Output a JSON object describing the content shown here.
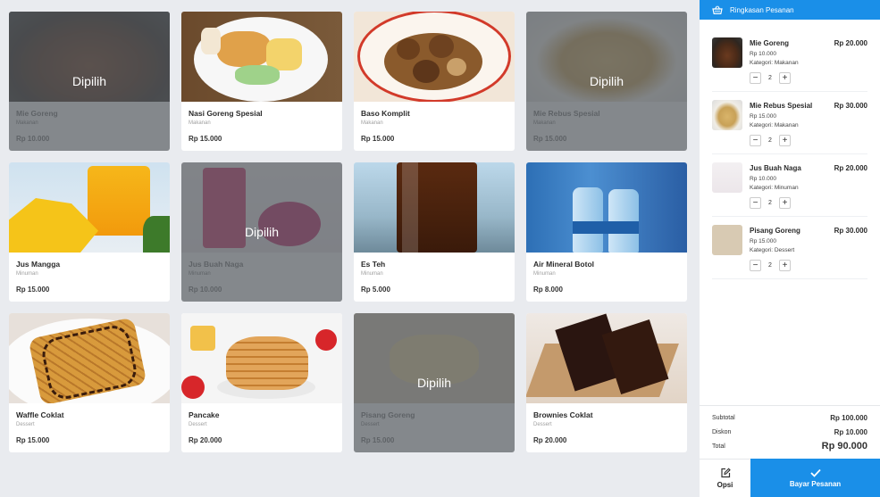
{
  "menu": [
    {
      "name": "Mie Goreng",
      "category": "Makanan",
      "price": "Rp 10.000",
      "selected": true,
      "selected_label": "Dipilih",
      "thumb": "t-dark"
    },
    {
      "name": "Nasi Goreng Spesial",
      "category": "Makanan",
      "price": "Rp 15.000",
      "selected": false,
      "selected_label": "",
      "thumb": "t-nasi"
    },
    {
      "name": "Baso Komplit",
      "category": "Makanan",
      "price": "Rp 15.000",
      "selected": false,
      "selected_label": "",
      "thumb": "t-baso"
    },
    {
      "name": "Mie Rebus Spesial",
      "category": "Makanan",
      "price": "Rp 15.000",
      "selected": true,
      "selected_label": "Dipilih",
      "thumb": "t-mierebus"
    },
    {
      "name": "Jus Mangga",
      "category": "Minuman",
      "price": "Rp 15.000",
      "selected": false,
      "selected_label": "",
      "thumb": "t-mangga"
    },
    {
      "name": "Jus Buah Naga",
      "category": "Minuman",
      "price": "Rp 10.000",
      "selected": true,
      "selected_label": "Dipilih",
      "thumb": "t-jusnaga"
    },
    {
      "name": "Es Teh",
      "category": "Minuman",
      "price": "Rp 5.000",
      "selected": false,
      "selected_label": "",
      "thumb": "t-esteh"
    },
    {
      "name": "Air Mineral Botol",
      "category": "Minuman",
      "price": "Rp 8.000",
      "selected": false,
      "selected_label": "",
      "thumb": "t-water"
    },
    {
      "name": "Waffle Coklat",
      "category": "Dessert",
      "price": "Rp 15.000",
      "selected": false,
      "selected_label": "",
      "thumb": "t-waffle"
    },
    {
      "name": "Pancake",
      "category": "Dessert",
      "price": "Rp 20.000",
      "selected": false,
      "selected_label": "",
      "thumb": "t-pancake"
    },
    {
      "name": "Pisang Goreng",
      "category": "Dessert",
      "price": "Rp 15.000",
      "selected": true,
      "selected_label": "Dipilih",
      "thumb": "t-pisang"
    },
    {
      "name": "Brownies Coklat",
      "category": "Dessert",
      "price": "Rp 20.000",
      "selected": false,
      "selected_label": "",
      "thumb": "t-brownie"
    }
  ],
  "sidebar": {
    "title": "Ringkasan Pesanan",
    "icon": "basket-icon",
    "orders": [
      {
        "name": "Mie Goreng",
        "unit_price": "Rp 10.000",
        "category": "Kategori: Makanan",
        "qty": "2",
        "total": "Rp 20.000"
      },
      {
        "name": "Mie Rebus Spesial",
        "unit_price": "Rp 15.000",
        "category": "Kategori: Makanan",
        "qty": "2",
        "total": "Rp 30.000"
      },
      {
        "name": "Jus Buah Naga",
        "unit_price": "Rp 10.000",
        "category": "Kategori: Minuman",
        "qty": "2",
        "total": "Rp 20.000"
      },
      {
        "name": "Pisang Goreng",
        "unit_price": "Rp 15.000",
        "category": "Kategori: Dessert",
        "qty": "2",
        "total": "Rp 30.000"
      }
    ],
    "summary": {
      "subtotal_label": "Subtotal",
      "subtotal": "Rp 100.000",
      "discount_label": "Diskon",
      "discount": "Rp 10.000",
      "total_label": "Total",
      "total": "Rp 90.000"
    }
  },
  "actions": {
    "options_label": "Opsi",
    "pay_label": "Bayar Pesanan"
  },
  "colors": {
    "accent": "#1a8fe8",
    "overlay": "#555a60"
  }
}
